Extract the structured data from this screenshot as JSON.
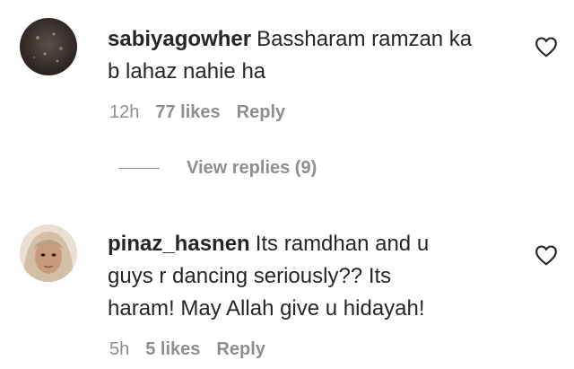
{
  "comments": [
    {
      "username": "sabiyagowher",
      "text_line1": "Bassharam ramzan ka",
      "text_line2": "b lahaz nahie ha",
      "time": "12h",
      "likes": "77 likes",
      "reply": "Reply"
    },
    {
      "username": "pinaz_hasnen",
      "text_line1": "Its ramdhan and u",
      "text_line2": "guys r dancing seriously?? Its",
      "text_line3": "haram! May Allah give u hidayah!",
      "time": "5h",
      "likes": "5 likes",
      "reply": "Reply"
    }
  ],
  "view_replies": {
    "label": "View replies (9)"
  },
  "icons": {
    "like": "heart-outline-icon"
  },
  "colors": {
    "text": "#262626",
    "secondary": "#8e8e8e",
    "background": "#ffffff"
  }
}
